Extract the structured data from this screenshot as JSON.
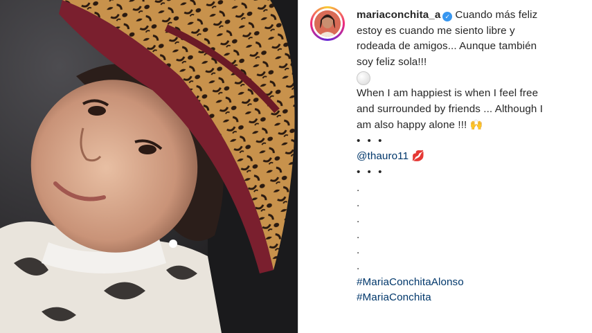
{
  "post": {
    "username": "mariaconchita_a",
    "verified_icon": "verified-badge-icon",
    "caption_es": [
      "Cuando más feliz",
      "estoy es cuando me siento libre y",
      "rodeada de amigos... Aunque también",
      "soy feliz sola!!!"
    ],
    "caption_en": [
      "When I am happiest is when I feel free",
      "and surrounded by friends ... Although I",
      "am also happy alone !!!"
    ],
    "ellipsis": "• • •",
    "mention": "@thauro11",
    "dot": ".",
    "hashtags": [
      "#MariaConchitaAlonso",
      "#MariaConchita"
    ],
    "emojis": {
      "circle": "white-circle-emoji",
      "hands": "raised-hands-emoji",
      "lips": "kiss-lips-emoji"
    }
  },
  "colors": {
    "link": "#00376b",
    "text": "#262626",
    "verified": "#3897f0"
  }
}
